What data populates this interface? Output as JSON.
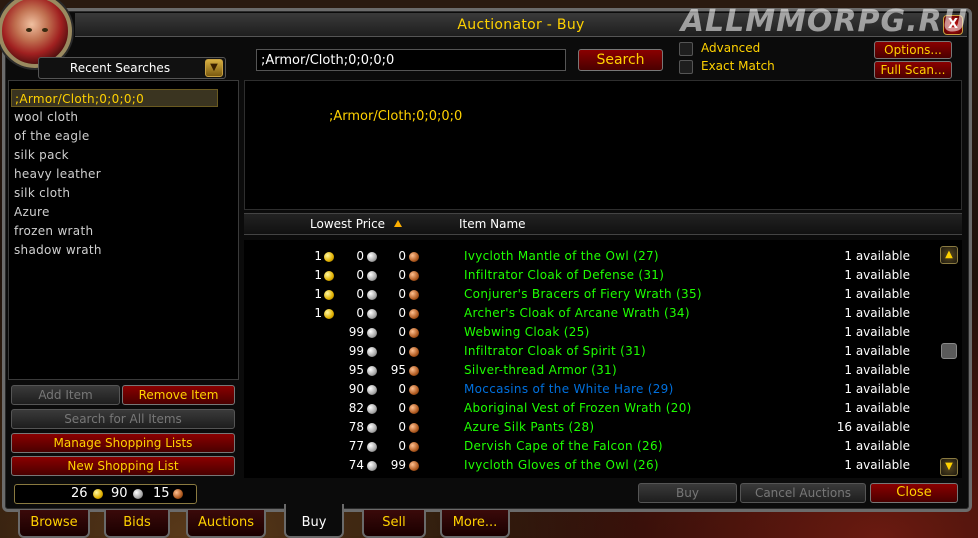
{
  "window": {
    "title": "Auctionator - Buy",
    "close_glyph": "X"
  },
  "watermark": "ALLMMORPG.RU",
  "sidebar": {
    "dropdown_label": "Recent Searches",
    "items": [
      ";Armor/Cloth;0;0;0;0",
      "wool cloth",
      "of the eagle",
      "silk pack",
      "heavy leather",
      "silk cloth",
      "Azure",
      "frozen wrath",
      "shadow wrath"
    ],
    "add_item": "Add Item",
    "remove_item": "Remove Item",
    "search_all": "Search for All Items",
    "manage_lists": "Manage Shopping Lists",
    "new_list": "New Shopping List"
  },
  "money": {
    "gold": "26",
    "silver": "90",
    "copper": "15"
  },
  "search": {
    "value": ";Armor/Cloth;0;0;0;0",
    "button": "Search",
    "advanced": "Advanced",
    "exact_match": "Exact Match",
    "options": "Options...",
    "full_scan": "Full Scan..."
  },
  "info_text": ";Armor/Cloth;0;0;0;0",
  "columns": {
    "price": "Lowest Price",
    "name": "Item Name"
  },
  "results": [
    {
      "g": "1",
      "s": "0",
      "c": "0",
      "name": "Ivycloth Mantle of the Owl (27)",
      "avail": "1 available",
      "quality": "uncommon"
    },
    {
      "g": "1",
      "s": "0",
      "c": "0",
      "name": "Infiltrator Cloak of Defense (31)",
      "avail": "1 available",
      "quality": "uncommon"
    },
    {
      "g": "1",
      "s": "0",
      "c": "0",
      "name": "Conjurer's Bracers of Fiery Wrath (35)",
      "avail": "1 available",
      "quality": "uncommon"
    },
    {
      "g": "1",
      "s": "0",
      "c": "0",
      "name": "Archer's Cloak of Arcane Wrath (34)",
      "avail": "1 available",
      "quality": "uncommon"
    },
    {
      "g": "",
      "s": "99",
      "c": "0",
      "name": "Webwing Cloak (25)",
      "avail": "1 available",
      "quality": "uncommon"
    },
    {
      "g": "",
      "s": "99",
      "c": "0",
      "name": "Infiltrator Cloak of Spirit (31)",
      "avail": "1 available",
      "quality": "uncommon"
    },
    {
      "g": "",
      "s": "95",
      "c": "95",
      "name": "Silver-thread Armor (31)",
      "avail": "1 available",
      "quality": "uncommon"
    },
    {
      "g": "",
      "s": "90",
      "c": "0",
      "name": "Moccasins of the White Hare (29)",
      "avail": "1 available",
      "quality": "rare"
    },
    {
      "g": "",
      "s": "82",
      "c": "0",
      "name": "Aboriginal Vest of Frozen Wrath (20)",
      "avail": "1 available",
      "quality": "uncommon"
    },
    {
      "g": "",
      "s": "78",
      "c": "0",
      "name": "Azure Silk Pants (28)",
      "avail": "16 available",
      "quality": "uncommon"
    },
    {
      "g": "",
      "s": "77",
      "c": "0",
      "name": "Dervish Cape of the Falcon (26)",
      "avail": "1 available",
      "quality": "uncommon"
    },
    {
      "g": "",
      "s": "74",
      "c": "99",
      "name": "Ivycloth Gloves of the Owl (26)",
      "avail": "1 available",
      "quality": "uncommon"
    }
  ],
  "actions": {
    "buy": "Buy",
    "cancel": "Cancel Auctions",
    "close": "Close"
  },
  "tabs": [
    "Browse",
    "Bids",
    "Auctions",
    "Buy",
    "Sell",
    "More..."
  ],
  "colors": {
    "uncommon": "#1eff00",
    "rare": "#0070dd",
    "accent": "#ffd200"
  }
}
